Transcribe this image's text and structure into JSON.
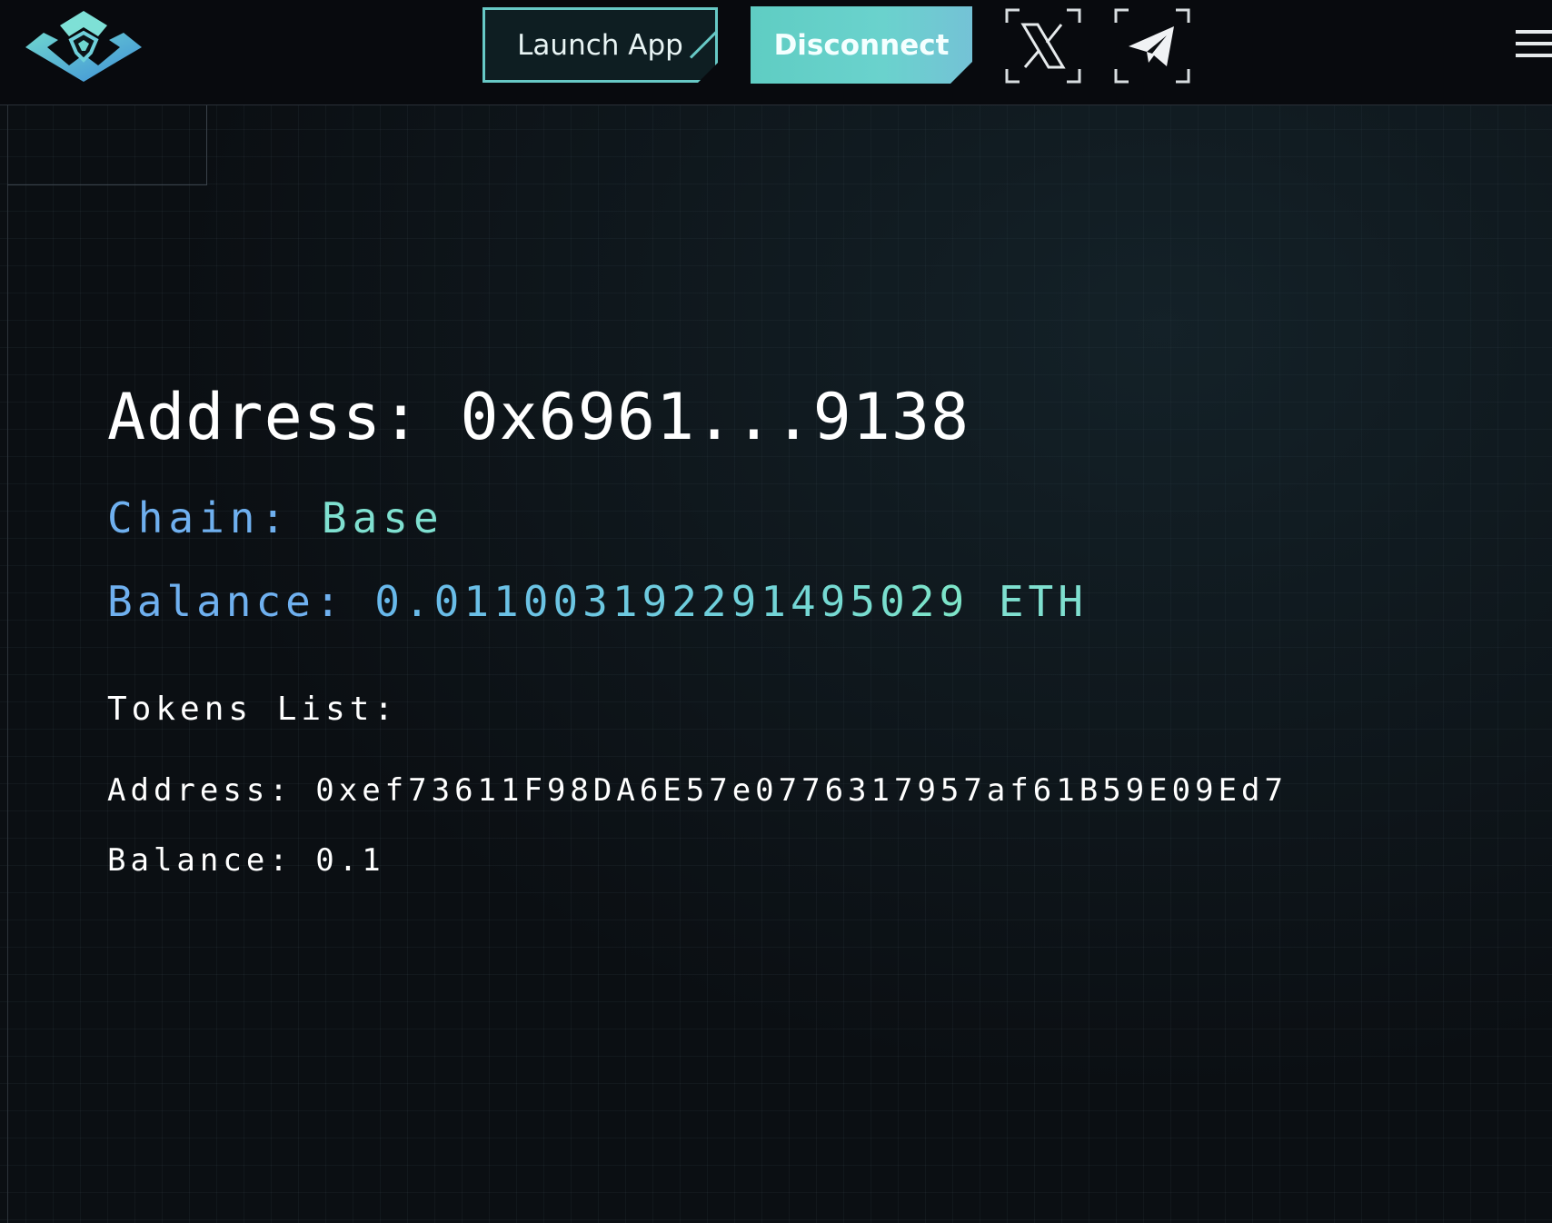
{
  "header": {
    "logo_icon": "brand-logo-icon",
    "launch_label": "Launch App",
    "disconnect_label": "Disconnect",
    "social": [
      {
        "icon": "x-icon"
      },
      {
        "icon": "telegram-icon"
      }
    ],
    "menu_icon": "hamburger-menu-icon"
  },
  "wallet": {
    "address_label": "Address:",
    "address_value": "0x6961...9138",
    "chain_label": "Chain:",
    "chain_value": "Base",
    "balance_label": "Balance:",
    "balance_value": "0.011003192291495029",
    "balance_unit": "ETH"
  },
  "tokens": {
    "heading": "Tokens List:",
    "items": [
      {
        "address_label": "Address:",
        "address": "0xef73611F98DA6E57e0776317957af61B59E09Ed7",
        "balance_label": "Balance:",
        "balance": "0.1"
      }
    ]
  },
  "colors": {
    "accent_teal": "#67c9c6",
    "label_blue": "#6fb0ef",
    "value_teal": "#7fe0d0",
    "background": "#0b0f13"
  }
}
